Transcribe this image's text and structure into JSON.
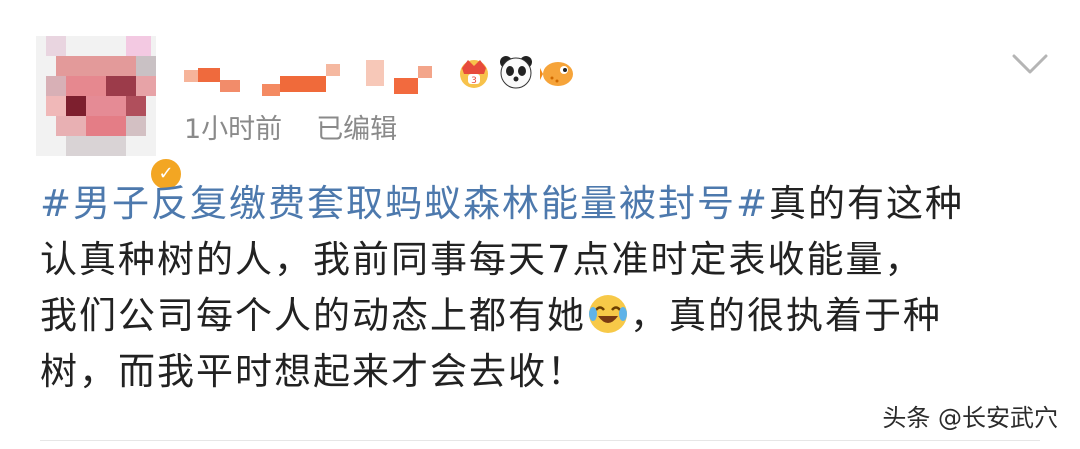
{
  "post": {
    "time": "1小时前",
    "edited": "已编辑",
    "topic": "#男子反复缴费套取蚂蚁森林能量被封号#",
    "line1_rest": "真的有这种",
    "line2": "认真种树的人，我前同事每天7点准时定表收能量，",
    "line3_a": "我们公司每个人的动态上都有她",
    "line3_b": "，真的很执着于种",
    "line4": "树，而我平时想起来才会去收！",
    "inline_emoji": "laughing-crying-emoji"
  },
  "badges": [
    "crown-badge-icon",
    "panda-icon",
    "pufferfish-icon"
  ],
  "avatar": {
    "verified_icon": "verified-v-icon"
  },
  "watermark": "头条 @长安武穴",
  "colors": {
    "topic": "#4d79ad",
    "meta": "#8a8a8a",
    "text": "#222222"
  }
}
